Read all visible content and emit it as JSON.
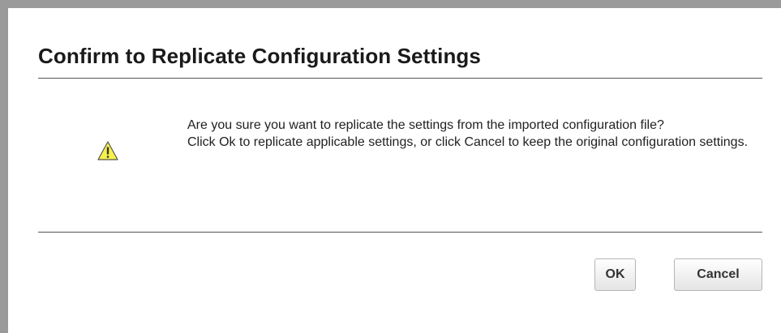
{
  "dialog": {
    "title": "Confirm to Replicate Configuration Settings",
    "icon": "warning-triangle-icon",
    "message_line1": "Are you sure you want to replicate the settings from the imported configuration file?",
    "message_line2": "Click Ok to replicate applicable settings, or click Cancel to keep the original configuration settings.",
    "ok_label": "OK",
    "cancel_label": "Cancel"
  },
  "colors": {
    "frame": "#9a9a9a",
    "divider": "#555555",
    "warning_fill": "#f6f24a",
    "warning_stroke": "#555555"
  }
}
